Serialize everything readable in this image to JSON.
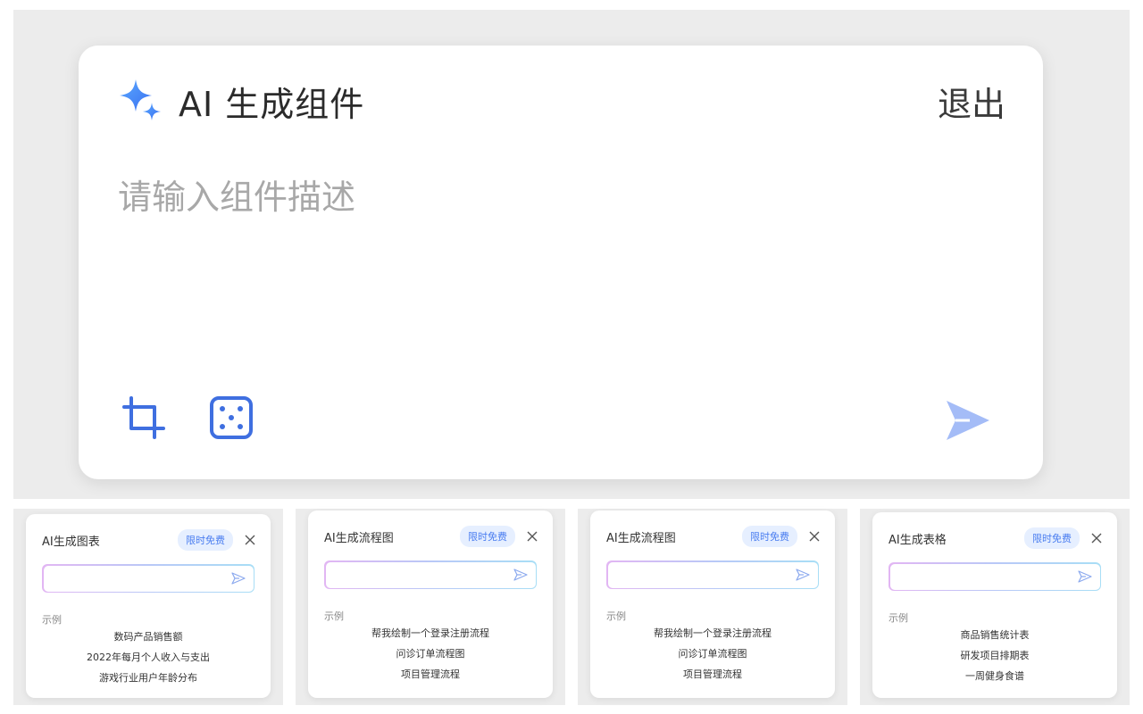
{
  "main": {
    "title": "AI 生成组件",
    "exit_label": "退出",
    "input_placeholder": "请输入组件描述",
    "icons": [
      "sparkle-icon",
      "crop-icon",
      "dice-icon",
      "send-icon"
    ],
    "accent_color": "#3f6fe0",
    "send_color": "#a4bcf7"
  },
  "cards": [
    {
      "title": "AI生成图表",
      "badge": "限时免费",
      "example_label": "示例",
      "examples": [
        "数码产品销售额",
        "2022年每月个人收入与支出",
        "游戏行业用户年龄分布"
      ]
    },
    {
      "title": "AI生成流程图",
      "badge": "限时免费",
      "example_label": "示例",
      "examples": [
        "帮我绘制一个登录注册流程",
        "问诊订单流程图",
        "项目管理流程"
      ]
    },
    {
      "title": "AI生成流程图",
      "badge": "限时免费",
      "example_label": "示例",
      "examples": [
        "帮我绘制一个登录注册流程",
        "问诊订单流程图",
        "项目管理流程"
      ]
    },
    {
      "title": "AI生成表格",
      "badge": "限时免费",
      "example_label": "示例",
      "examples": [
        "商品销售统计表",
        "研发项目排期表",
        "一周健身食谱"
      ]
    }
  ]
}
